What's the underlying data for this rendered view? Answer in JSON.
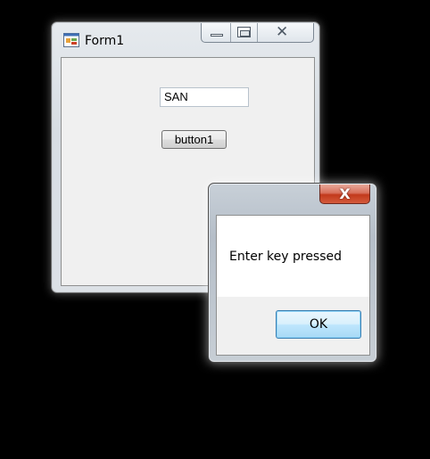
{
  "form1": {
    "title": "Form1",
    "icon": "windows-form-app-icon",
    "textbox_value": "SAN",
    "button_label": "button1"
  },
  "messagebox": {
    "close_symbol": "X",
    "message": "Enter key pressed",
    "ok_label": "OK"
  },
  "colors": {
    "ok_button_border": "#3c7fb1",
    "close_button": "#c2391c"
  }
}
